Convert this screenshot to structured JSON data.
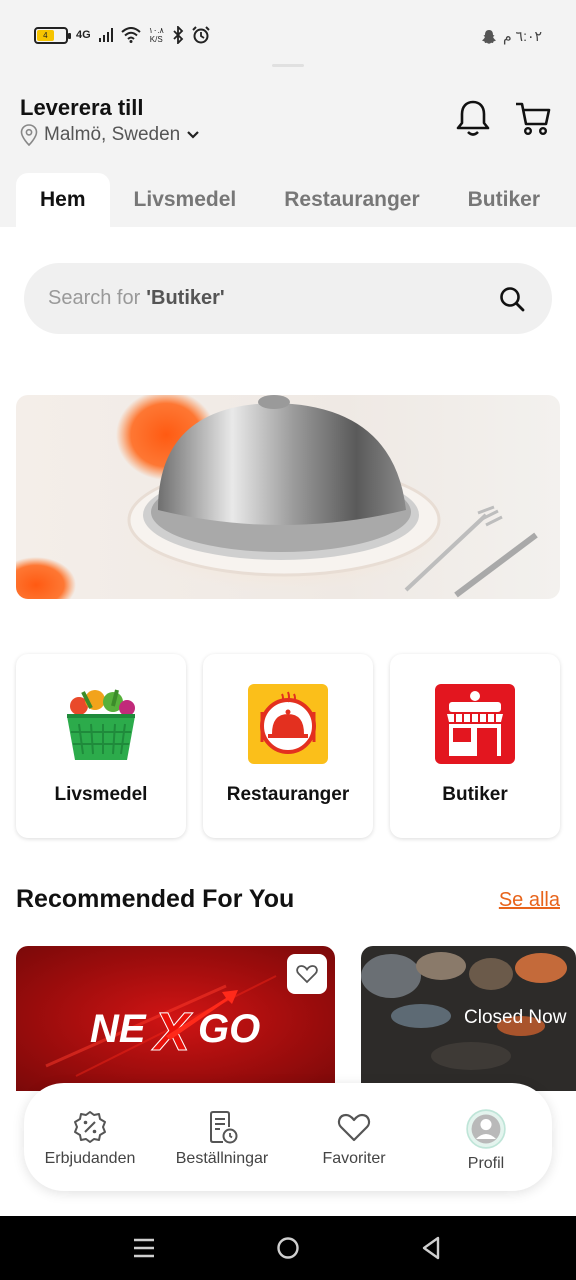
{
  "status_bar": {
    "battery": "4",
    "network": "4G",
    "speed_value": "١٠.٨",
    "speed_unit": "K/S",
    "time": "٦:٠٢ م"
  },
  "header": {
    "deliver_title": "Leverera till",
    "location": "Malmö, Sweden"
  },
  "tabs": [
    {
      "label": "Hem",
      "active": true
    },
    {
      "label": "Livsmedel",
      "active": false
    },
    {
      "label": "Restauranger",
      "active": false
    },
    {
      "label": "Butiker",
      "active": false
    }
  ],
  "search": {
    "placeholder_prefix": "Search for",
    "placeholder_highlight": "'Butiker'"
  },
  "categories": [
    {
      "label": "Livsmedel",
      "icon": "grocery-basket-icon"
    },
    {
      "label": "Restauranger",
      "icon": "restaurant-cloche-icon"
    },
    {
      "label": "Butiker",
      "icon": "store-front-icon"
    }
  ],
  "recommended": {
    "title": "Recommended For You",
    "see_all": "Se alla",
    "cards": [
      {
        "logo_text_1": "NE",
        "logo_text_2": "X",
        "logo_text_3": "GO"
      },
      {
        "status": "Closed Now"
      }
    ]
  },
  "bottom_nav": [
    {
      "label": "Erbjudanden",
      "icon": "discount-badge-icon"
    },
    {
      "label": "Beställningar",
      "icon": "orders-clock-icon"
    },
    {
      "label": "Favoriter",
      "icon": "heart-icon"
    },
    {
      "label": "Profil",
      "icon": "profile-icon"
    }
  ],
  "colors": {
    "accent": "#e8641b",
    "banner_orange": "#ff5a12",
    "card_red": "#c41010"
  }
}
